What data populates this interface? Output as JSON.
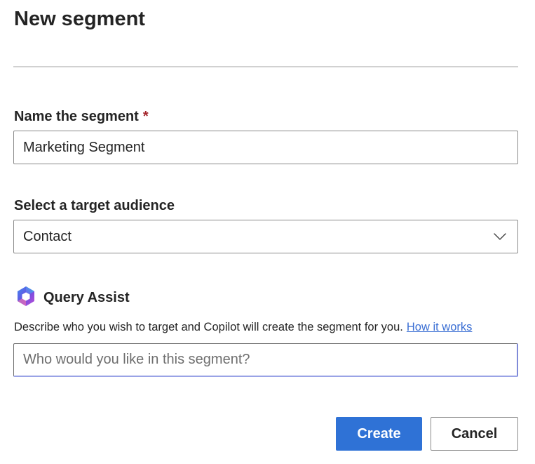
{
  "dialog": {
    "title": "New segment"
  },
  "name_field": {
    "label": "Name the segment",
    "required_mark": "*",
    "value": "Marketing Segment"
  },
  "audience_field": {
    "label": "Select a target audience",
    "selected": "Contact",
    "icon": "chevron-down-icon"
  },
  "query_assist": {
    "title": "Query Assist",
    "icon": "copilot-icon",
    "description": "Describe who you wish to target and Copilot will create the segment for you.",
    "link_text": "How it works",
    "placeholder": "Who would you like in this segment?",
    "value": ""
  },
  "actions": {
    "create_label": "Create",
    "cancel_label": "Cancel"
  },
  "colors": {
    "primary": "#2f72d6",
    "required": "#a4262c",
    "link": "#3b6fd4"
  }
}
